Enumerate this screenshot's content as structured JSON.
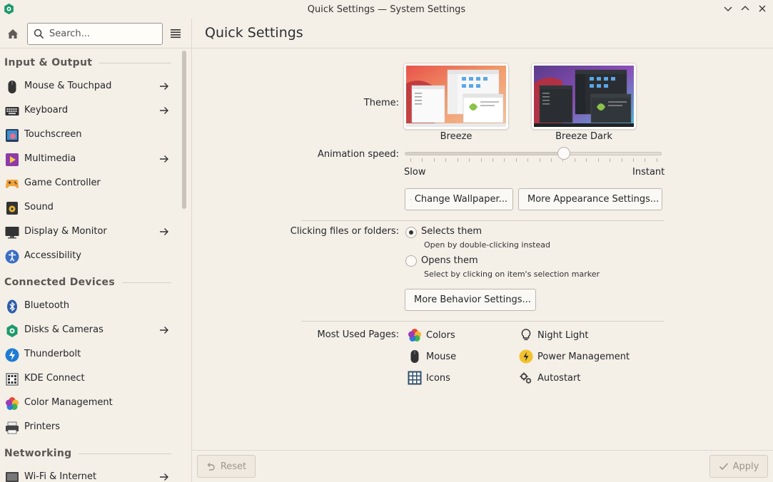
{
  "window": {
    "title": "Quick Settings — System Settings"
  },
  "toolbar": {
    "search_placeholder": "Search..."
  },
  "page": {
    "title": "Quick Settings"
  },
  "sidebar": {
    "sections": [
      {
        "title": "Input & Output"
      },
      {
        "title": "Connected Devices"
      },
      {
        "title": "Networking"
      }
    ],
    "items": [
      {
        "label": "Mouse & Touchpad",
        "icon": "mouse-icon",
        "has_arrow": true
      },
      {
        "label": "Keyboard",
        "icon": "keyboard-icon",
        "has_arrow": true
      },
      {
        "label": "Touchscreen",
        "icon": "touchscreen-icon",
        "has_arrow": false
      },
      {
        "label": "Multimedia",
        "icon": "multimedia-icon",
        "has_arrow": true
      },
      {
        "label": "Game Controller",
        "icon": "gamepad-icon",
        "has_arrow": false
      },
      {
        "label": "Sound",
        "icon": "speaker-icon",
        "has_arrow": false
      },
      {
        "label": "Display & Monitor",
        "icon": "monitor-icon",
        "has_arrow": true
      },
      {
        "label": "Accessibility",
        "icon": "accessibility-icon",
        "has_arrow": false
      },
      {
        "label": "Bluetooth",
        "icon": "bluetooth-icon",
        "has_arrow": false
      },
      {
        "label": "Disks & Cameras",
        "icon": "disks-icon",
        "has_arrow": true
      },
      {
        "label": "Thunderbolt",
        "icon": "thunderbolt-icon",
        "has_arrow": false
      },
      {
        "label": "KDE Connect",
        "icon": "kde-connect-icon",
        "has_arrow": false
      },
      {
        "label": "Color Management",
        "icon": "color-management-icon",
        "has_arrow": false
      },
      {
        "label": "Printers",
        "icon": "printer-icon",
        "has_arrow": false
      },
      {
        "label": "Wi-Fi & Internet",
        "icon": "network-icon",
        "has_arrow": true
      }
    ]
  },
  "theme": {
    "label": "Theme:",
    "options": [
      {
        "name": "Breeze",
        "selected": false
      },
      {
        "name": "Breeze Dark",
        "selected": false
      }
    ]
  },
  "animation": {
    "label": "Animation speed:",
    "min_label": "Slow",
    "max_label": "Instant",
    "value_fraction": 0.62
  },
  "appearance_buttons": {
    "wallpaper": "Change Wallpaper...",
    "more_appearance": "More Appearance Settings..."
  },
  "clicking": {
    "label": "Clicking files or folders:",
    "options": [
      {
        "label": "Selects them",
        "hint": "Open by double-clicking instead",
        "checked": true
      },
      {
        "label": "Opens them",
        "hint": "Select by clicking on item's selection marker",
        "checked": false
      }
    ],
    "more_behavior": "More Behavior Settings..."
  },
  "most_used": {
    "label": "Most Used Pages:",
    "items": [
      {
        "label": "Colors",
        "icon": "colors-icon"
      },
      {
        "label": "Night Light",
        "icon": "lightbulb-icon"
      },
      {
        "label": "Mouse",
        "icon": "mouse-icon"
      },
      {
        "label": "Power Management",
        "icon": "power-icon"
      },
      {
        "label": "Icons",
        "icon": "icons-grid-icon"
      },
      {
        "label": "Autostart",
        "icon": "gears-icon"
      }
    ]
  },
  "footer": {
    "reset": "Reset",
    "apply": "Apply"
  },
  "colors": {
    "background": "#f4efe7",
    "accent": "#3daee9"
  }
}
